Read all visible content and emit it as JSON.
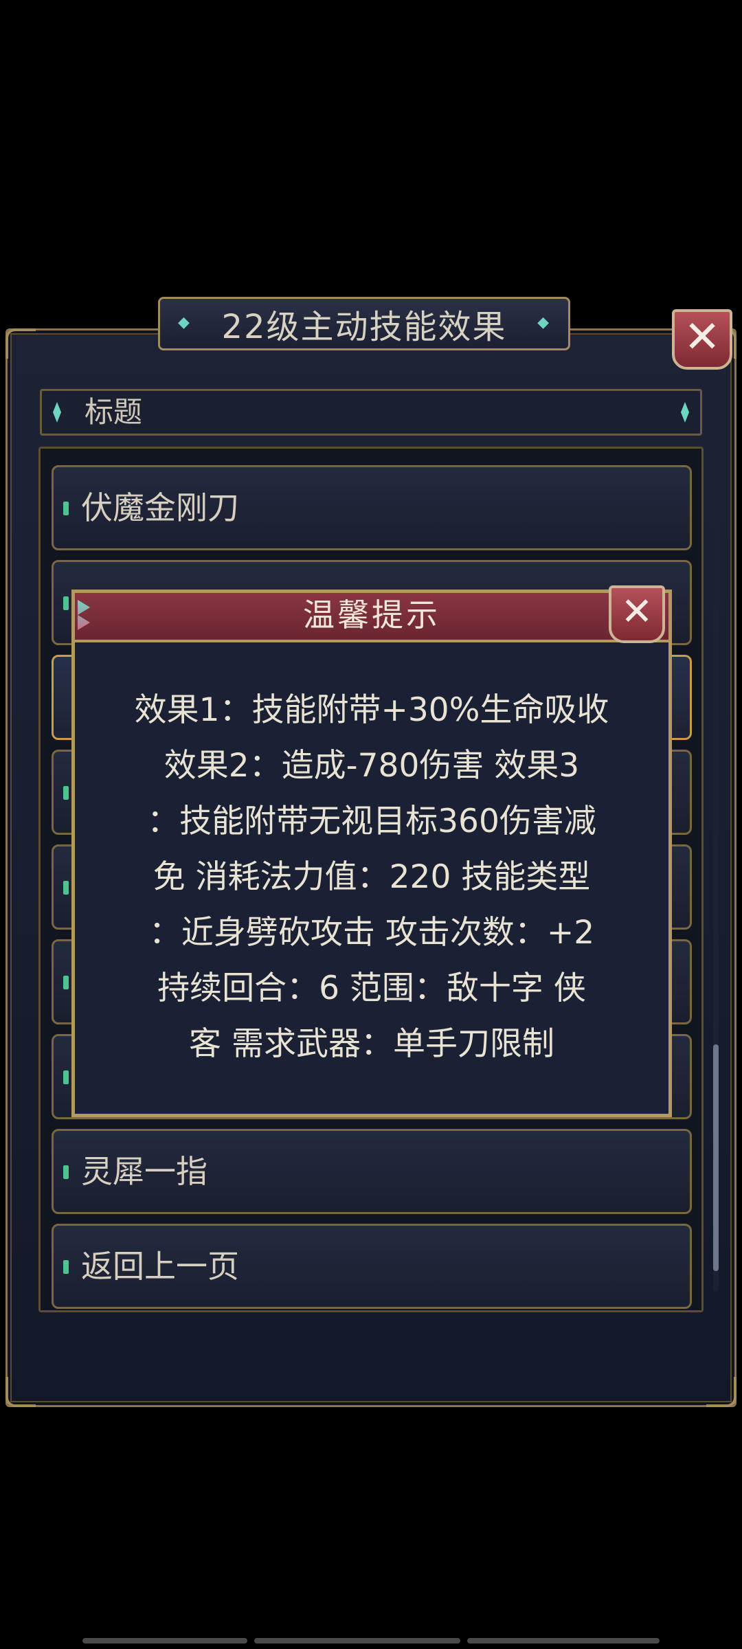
{
  "panel": {
    "title": "22级主动技能效果",
    "header": "标题"
  },
  "list": {
    "items": [
      {
        "label": "伏魔金刚刀"
      },
      {
        "label": ""
      },
      {
        "label": ""
      },
      {
        "label": ""
      },
      {
        "label": ""
      },
      {
        "label": ""
      },
      {
        "label": ""
      },
      {
        "label": "灵犀一指"
      },
      {
        "label": "返回上一页"
      }
    ]
  },
  "dialog": {
    "title": "温馨提示",
    "lines": [
      "效果1：技能附带+30%生命吸收",
      "效果2：造成-780伤害 效果3",
      "：技能附带无视目标360伤害减",
      "免 消耗法力值：220 技能类型",
      "：近身劈砍攻击 攻击次数：+2",
      "持续回合：6 范围：敌十字 侠",
      "客 需求武器：单手刀限制"
    ]
  },
  "icons": {
    "close": "✕"
  },
  "colors": {
    "accent_gold": "#b49a62",
    "dialog_header": "#7a2e3a",
    "marker_green": "#4ec28f"
  }
}
